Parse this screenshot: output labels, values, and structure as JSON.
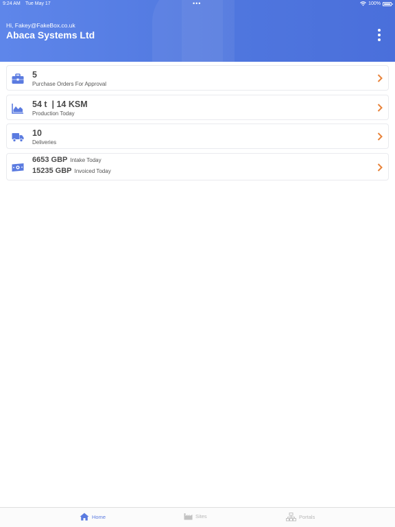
{
  "status_bar": {
    "time": "9:24 AM",
    "date": "Tue May 17",
    "battery": "100%"
  },
  "header": {
    "greeting_prefix": "Hi, ",
    "email": "Fakey@FakeBox.co.uk",
    "company": "Abaca Systems Ltd"
  },
  "cards": {
    "purchase_orders": {
      "value": "5",
      "label": "Purchase Orders For Approval",
      "icon": "briefcase-icon"
    },
    "production": {
      "value": "54 t  | 14 KSM",
      "label": "Production Today",
      "icon": "area-chart-icon"
    },
    "deliveries": {
      "value": "10",
      "label": "Deliveries",
      "icon": "truck-icon"
    },
    "finance": {
      "intake_value": "6653 GBP",
      "intake_label": "Intake Today",
      "invoiced_value": "15235 GBP",
      "invoiced_label": "Invoiced Today",
      "icon": "money-icon"
    }
  },
  "tabs": [
    {
      "label": "Home",
      "icon": "home-icon",
      "active": true
    },
    {
      "label": "Sites",
      "icon": "factory-icon",
      "active": false
    },
    {
      "label": "Portals",
      "icon": "network-icon",
      "active": false
    }
  ],
  "colors": {
    "accent": "#5b7be0",
    "chevron": "#e8833a",
    "header_start": "#5e86ea",
    "header_end": "#4a6fdb"
  }
}
